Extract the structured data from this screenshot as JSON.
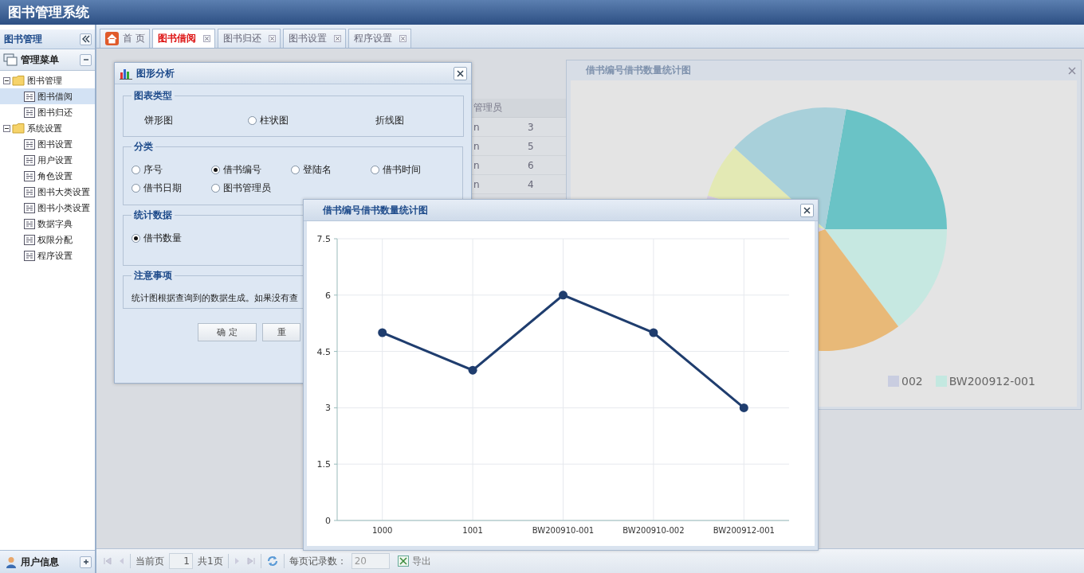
{
  "app": {
    "title": "图书管理系统"
  },
  "sidebar": {
    "title": "图书管理",
    "menu_title": "管理菜单",
    "footer": "用户信息",
    "tree": [
      {
        "label": "图书管理",
        "expanded": true,
        "selected": false,
        "children": [
          {
            "label": "图书借阅",
            "selected": true
          },
          {
            "label": "图书归还",
            "selected": false
          }
        ]
      },
      {
        "label": "系统设置",
        "expanded": true,
        "selected": false,
        "children": [
          {
            "label": "图书设置",
            "selected": false
          },
          {
            "label": "用户设置",
            "selected": false
          },
          {
            "label": "角色设置",
            "selected": false
          },
          {
            "label": "图书大类设置",
            "selected": false
          },
          {
            "label": "图书小类设置",
            "selected": false
          },
          {
            "label": "数据字典",
            "selected": false
          },
          {
            "label": "权限分配",
            "selected": false
          },
          {
            "label": "程序设置",
            "selected": false
          }
        ]
      }
    ]
  },
  "tabs": [
    {
      "label": "首 页",
      "kind": "home",
      "selected": false,
      "closable": false
    },
    {
      "label": "图书借阅",
      "kind": "page",
      "selected": true,
      "closable": true
    },
    {
      "label": "图书归还",
      "kind": "page",
      "selected": false,
      "closable": true
    },
    {
      "label": "图书设置",
      "kind": "page",
      "selected": false,
      "closable": true
    },
    {
      "label": "程序设置",
      "kind": "page",
      "selected": false,
      "closable": true
    }
  ],
  "background_table": {
    "column_header": "管理员",
    "rows": [
      {
        "column_1": "n",
        "column_2": "3"
      },
      {
        "column_1": "n",
        "column_2": "5"
      },
      {
        "column_1": "n",
        "column_2": "6"
      },
      {
        "column_1": "n",
        "column_2": "4"
      }
    ]
  },
  "dialog": {
    "title": "图形分析",
    "sections": [
      {
        "legend": "图表类型",
        "options": [
          {
            "label": "饼形图",
            "kind": "plain",
            "selected": false
          },
          {
            "label": "柱状图",
            "kind": "radio",
            "selected": false
          },
          {
            "label": "折线图",
            "kind": "plain",
            "selected": false
          }
        ]
      },
      {
        "legend": "分类",
        "options": [
          {
            "label": "序号",
            "kind": "radio",
            "selected": false
          },
          {
            "label": "借书编号",
            "kind": "radio",
            "selected": true
          },
          {
            "label": "登陆名",
            "kind": "radio",
            "selected": false
          },
          {
            "label": "借书时间",
            "kind": "radio",
            "selected": false
          },
          {
            "label": "借书日期",
            "kind": "radio",
            "selected": false
          },
          {
            "label": "图书管理员",
            "kind": "radio",
            "selected": false
          }
        ]
      },
      {
        "legend": "统计数据",
        "options": [
          {
            "label": "借书数量",
            "kind": "radio",
            "selected": true
          }
        ]
      },
      {
        "legend": "注意事项",
        "note": "统计图根据查询到的数据生成。如果没有查"
      }
    ],
    "buttons": [
      "确 定",
      "重"
    ]
  },
  "pie_window": {
    "title": "借书编号借书数量统计图",
    "legend": [
      {
        "label": "002",
        "color": "#c9cde0"
      },
      {
        "label": "BW200912-001",
        "color": "#c3e8e0"
      }
    ]
  },
  "line_window": {
    "title": "借书编号借书数量统计图",
    "chart_data": {
      "type": "line",
      "categories": [
        "1000",
        "1001",
        "BW200910-001",
        "BW200910-002",
        "BW200912-001"
      ],
      "series": [
        {
          "color": "#1f3d6e",
          "marker": "circle",
          "values": [
            5,
            4,
            6,
            5,
            3
          ]
        }
      ],
      "ylim": [
        0,
        7.5
      ],
      "yticks": [
        0,
        1.5,
        3,
        4.5,
        6,
        7.5
      ],
      "grid": true
    }
  },
  "pager": {
    "current_label": "当前页",
    "page": "1",
    "total": "共1页",
    "page_size_label": "每页记录数：",
    "page_size": "20",
    "export": "导出"
  }
}
